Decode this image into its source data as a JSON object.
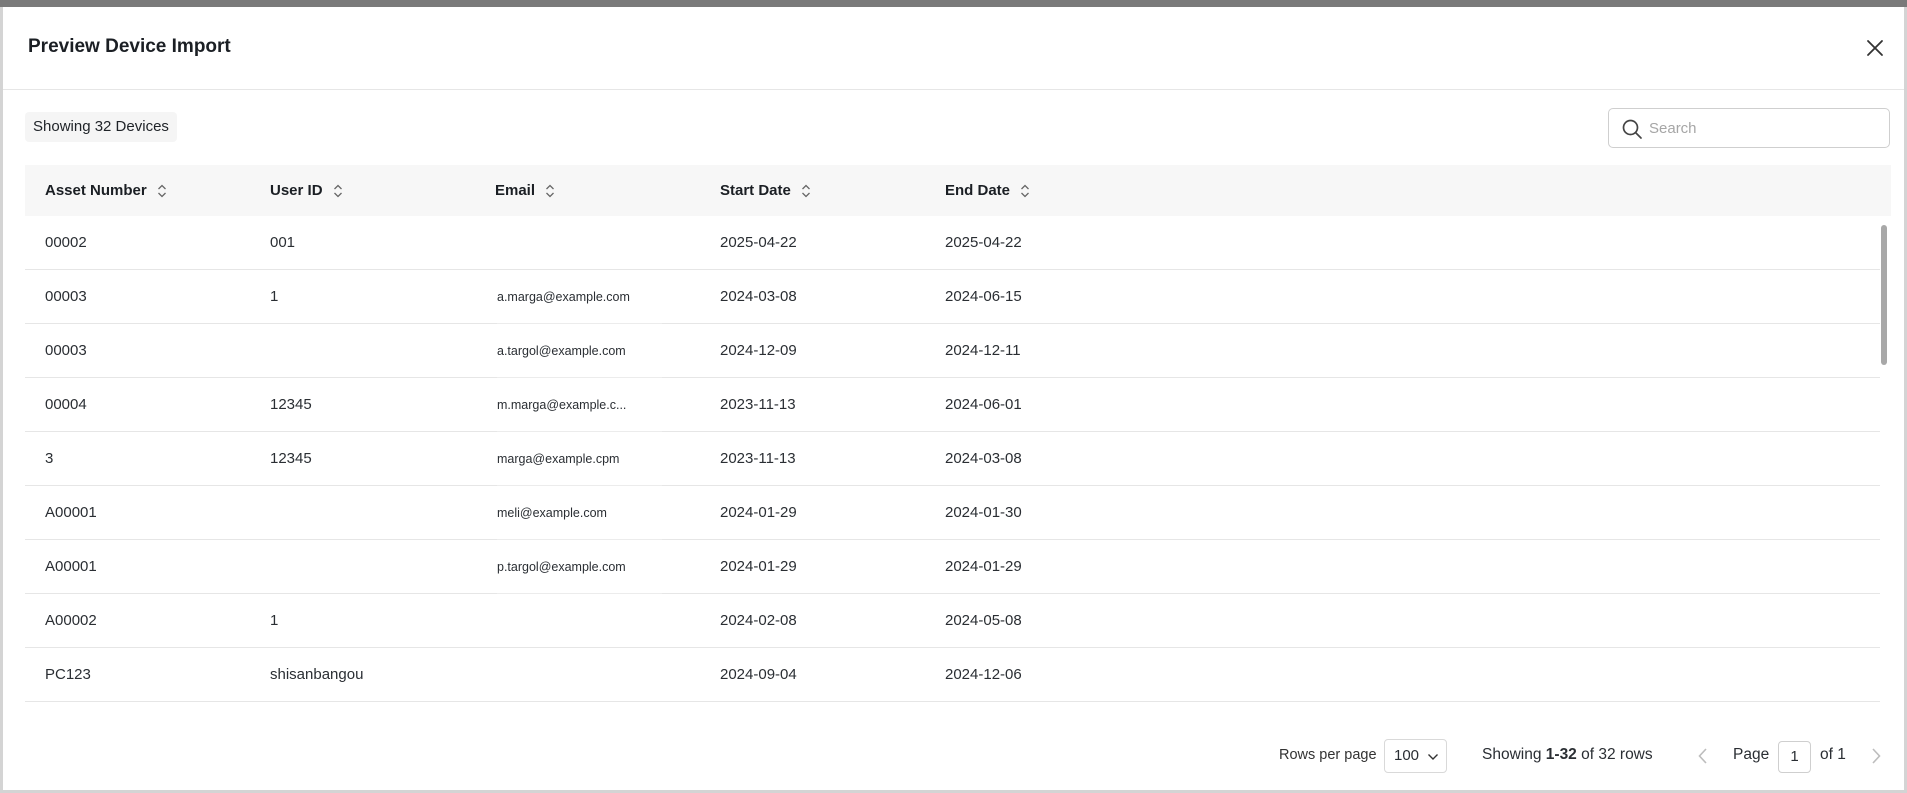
{
  "dialog": {
    "title": "Preview Device Import"
  },
  "toolbar": {
    "count_label": "Showing 32 Devices",
    "search_placeholder": "Search"
  },
  "table": {
    "columns": [
      "Asset Number",
      "User ID",
      "Email",
      "Start Date",
      "End Date"
    ],
    "rows": [
      {
        "asset": "00002",
        "user": "001",
        "email": "",
        "start": "2025-04-22",
        "end": "2025-04-22"
      },
      {
        "asset": "00003",
        "user": "1",
        "email": "a.marga@example.com",
        "start": "2024-03-08",
        "end": "2024-06-15"
      },
      {
        "asset": "00003",
        "user": "",
        "email": "a.targol@example.com",
        "start": "2024-12-09",
        "end": "2024-12-11"
      },
      {
        "asset": "00004",
        "user": "12345",
        "email": "m.marga@example.c...",
        "start": "2023-11-13",
        "end": "2024-06-01"
      },
      {
        "asset": "3",
        "user": "12345",
        "email": "marga@example.cpm",
        "start": "2023-11-13",
        "end": "2024-03-08"
      },
      {
        "asset": "A00001",
        "user": "",
        "email": "meli@example.com",
        "start": "2024-01-29",
        "end": "2024-01-30"
      },
      {
        "asset": "A00001",
        "user": "",
        "email": "p.targol@example.com",
        "start": "2024-01-29",
        "end": "2024-01-29"
      },
      {
        "asset": "A00002",
        "user": "1",
        "email": "",
        "start": "2024-02-08",
        "end": "2024-05-08"
      },
      {
        "asset": "PC123",
        "user": "shisanbangou",
        "email": "",
        "start": "2024-09-04",
        "end": "2024-12-06"
      }
    ]
  },
  "pagination": {
    "rows_per_page_label": "Rows per page",
    "rows_per_page_value": "100",
    "showing_prefix": "Showing",
    "showing_range": "1-32",
    "showing_suffix": "of 32 rows",
    "page_label": "Page",
    "page_value": "1",
    "of_label": "of 1"
  },
  "icons": {
    "close": "close-icon",
    "search": "search-icon",
    "sort": "sort-icon",
    "prev": "chevron-left-icon",
    "next": "chevron-right-icon",
    "dropdown": "chevron-down-icon"
  }
}
